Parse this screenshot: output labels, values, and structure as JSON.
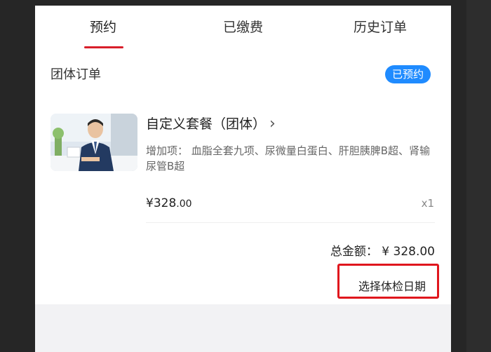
{
  "tabs": [
    {
      "label": "预约",
      "active": true
    },
    {
      "label": "已缴费",
      "active": false
    },
    {
      "label": "历史订单",
      "active": false
    }
  ],
  "order": {
    "section_title": "团体订单",
    "status": "已预约",
    "product_title": "自定义套餐（团体）",
    "addons_text": "增加项： 血脂全套九项、尿微量白蛋白、肝胆胰脾B超、肾输尿管B超",
    "price_main": "¥328",
    "price_decimals": ".00",
    "quantity": "x1",
    "total": "总金额： ¥ 328.00",
    "select_date_label": "选择体检日期"
  },
  "colors": {
    "accent_red": "#d81e2a",
    "badge_blue": "#1f8bff",
    "highlight_red": "#e0161d"
  },
  "icons": {
    "detail_arrow": "chevron-right-icon"
  }
}
